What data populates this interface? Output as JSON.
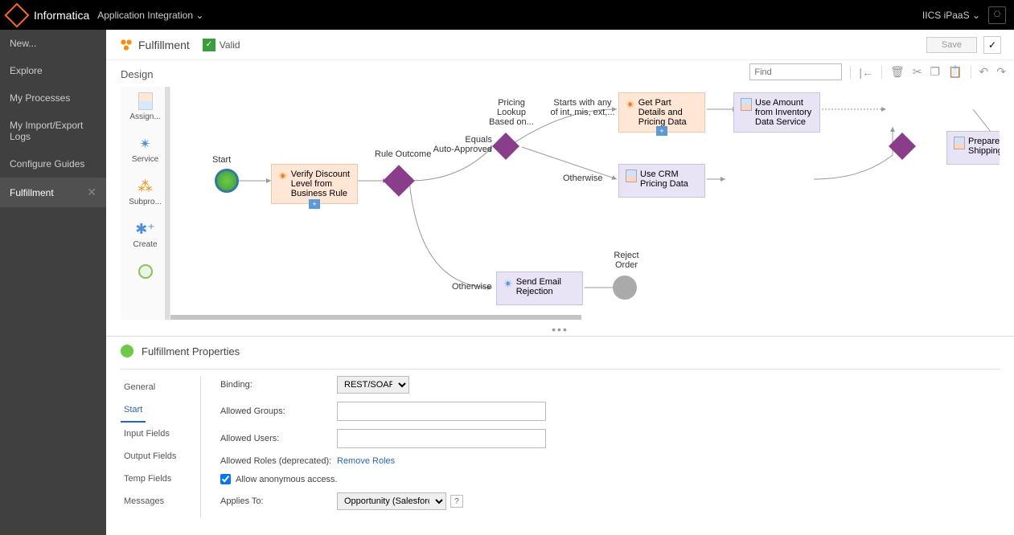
{
  "header": {
    "brand": "Informatica",
    "app": "Application Integration",
    "env": "IICS iPaaS"
  },
  "sidebar": {
    "items": [
      "New...",
      "Explore",
      "My Processes",
      "My Import/Export Logs",
      "Configure Guides",
      "Fulfillment"
    ]
  },
  "process": {
    "name": "Fulfillment",
    "status": "Valid",
    "save": "Save"
  },
  "design": {
    "title": "Design",
    "find_placeholder": "Find",
    "palette": [
      "Assign...",
      "Service",
      "Subpro...",
      "Create"
    ],
    "nodes": {
      "start": "Start",
      "verify": "Verify Discount Level from Business Rule",
      "rule_outcome": "Rule Outcome",
      "equals_auto": "Equals\nAuto-Approved",
      "pricing_lookup": "Pricing\nLookup\nBased on...",
      "starts_with": "Starts with any\nof int, mis, ext,...",
      "get_part": "Get Part Details and Pricing Data",
      "use_amount": "Use Amount from Inventory Data Service",
      "otherwise1": "Otherwise",
      "use_crm": "Use CRM Pricing Data",
      "prepare_ship": "Prepare Shipping",
      "otherwise2": "Otherwise",
      "send_email": "Send Email Rejection",
      "reject": "Reject\nOrder"
    }
  },
  "props": {
    "title": "Fulfillment Properties",
    "tabs": [
      "General",
      "Start",
      "Input Fields",
      "Output Fields",
      "Temp Fields",
      "Messages"
    ],
    "form": {
      "binding_label": "Binding:",
      "binding_value": "REST/SOAP",
      "allowed_groups": "Allowed Groups:",
      "allowed_users": "Allowed Users:",
      "allowed_roles": "Allowed Roles (deprecated):",
      "remove_roles": "Remove Roles",
      "anon_access": "Allow anonymous access.",
      "applies_to": "Applies To:",
      "applies_value": "Opportunity (Salesforce)"
    }
  }
}
